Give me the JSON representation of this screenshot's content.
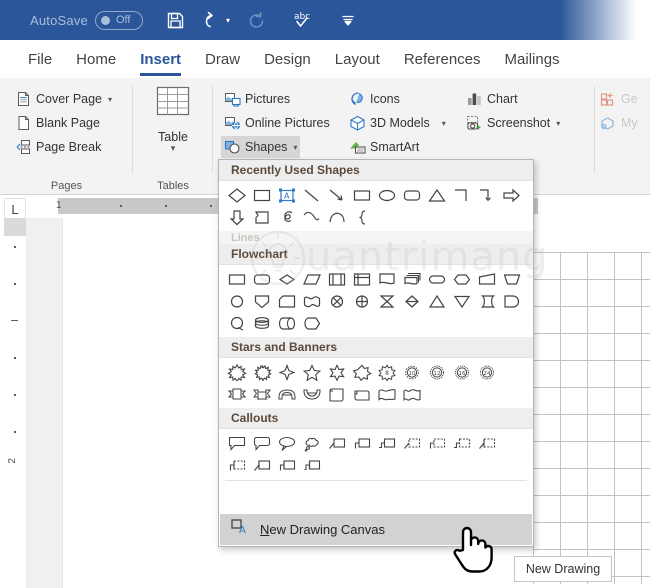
{
  "titlebar": {
    "autosave_label": "AutoSave",
    "autosave_state": "Off",
    "save_icon": "save-icon",
    "undo_icon": "undo-icon",
    "redo_icon": "redo-icon",
    "spelling_icon": "spelling-check-icon",
    "customize_icon": "customize-quick-access-toolbar-icon",
    "accent_color": "#2b579a"
  },
  "tabs": [
    {
      "label": "File",
      "active": false
    },
    {
      "label": "Home",
      "active": false
    },
    {
      "label": "Insert",
      "active": true
    },
    {
      "label": "Draw",
      "active": false
    },
    {
      "label": "Design",
      "active": false
    },
    {
      "label": "Layout",
      "active": false
    },
    {
      "label": "References",
      "active": false
    },
    {
      "label": "Mailings",
      "active": false
    }
  ],
  "ribbon": {
    "groups": [
      {
        "name": "Pages",
        "label": "Pages"
      },
      {
        "name": "Tables",
        "label": "Tables"
      },
      {
        "name": "Illustrations",
        "label": ""
      },
      {
        "name": "Add-ins",
        "label": ""
      }
    ],
    "pages": {
      "cover_page": "Cover Page",
      "blank_page": "Blank Page",
      "page_break": "Page Break"
    },
    "tables": {
      "table": "Table"
    },
    "illustrations": {
      "pictures": "Pictures",
      "online_pictures": "Online Pictures",
      "shapes": "Shapes",
      "icons": "Icons",
      "models_3d": "3D Models",
      "smartart": "SmartArt",
      "chart": "Chart",
      "screenshot": "Screenshot"
    },
    "addins": {
      "get_addins": "Ge",
      "my_addins": "My"
    }
  },
  "shapes_menu": {
    "sections": [
      {
        "title": "Recently Used Shapes",
        "faded": false,
        "rows": [
          [
            "diamond",
            "rectangle",
            "text-box",
            "line",
            "line-arrow",
            "rectangle",
            "oval",
            "rounded-rectangle",
            "isosceles-triangle",
            "elbow-connector",
            "elbow-arrow-connector",
            "right-arrow"
          ],
          [
            "down-arrow",
            "pentagon-flag",
            "scribble",
            "curve",
            "arc",
            "left-brace"
          ]
        ]
      },
      {
        "title": "Lines",
        "faded": true,
        "rows": []
      },
      {
        "title": "Flowchart",
        "faded": false,
        "rows": [
          [
            "flowchart-process",
            "flowchart-alternate-process",
            "flowchart-decision",
            "flowchart-data",
            "flowchart-predefined-process",
            "flowchart-internal-storage",
            "flowchart-document",
            "flowchart-multidocument",
            "flowchart-terminator",
            "flowchart-preparation",
            "flowchart-manual-input",
            "flowchart-manual-operation"
          ],
          [
            "flowchart-connector",
            "flowchart-off-page-connector",
            "flowchart-card",
            "flowchart-punched-tape",
            "flowchart-summing-junction",
            "flowchart-or",
            "flowchart-collate",
            "flowchart-sort",
            "flowchart-extract",
            "flowchart-merge",
            "flowchart-stored-data",
            "flowchart-delay"
          ],
          [
            "flowchart-sequential-access-storage",
            "flowchart-magnetic-disk",
            "flowchart-direct-access-storage",
            "flowchart-display"
          ]
        ]
      },
      {
        "title": "Stars and Banners",
        "faded": false,
        "rows": [
          [
            "explosion-1",
            "explosion-2",
            "star-4-point",
            "star-5-point",
            "star-6-point",
            "star-7-point",
            "star-8-point",
            "star-10-point",
            "star-12-point",
            "star-16-point",
            "star-24-point"
          ],
          [
            "up-ribbon",
            "down-ribbon",
            "curved-up-ribbon",
            "curved-down-ribbon",
            "vertical-scroll",
            "horizontal-scroll",
            "wave",
            "double-wave"
          ]
        ]
      },
      {
        "title": "Callouts",
        "faded": false,
        "rows": [
          [
            "rectangular-callout",
            "rounded-rectangular-callout",
            "oval-callout",
            "cloud-callout",
            "line-callout-1",
            "line-callout-2",
            "line-callout-3",
            "line-callout-1-border-accent",
            "line-callout-2-border-accent",
            "line-callout-3-border-accent",
            "line-callout-1-accent-bar"
          ],
          [
            "line-callout-2-accent-bar",
            "line-callout-3-accent-bar",
            "line-callout-1-no-border",
            "line-callout-2-no-border"
          ]
        ]
      }
    ],
    "new_drawing_canvas": {
      "label_underlined": "N",
      "label_rest": "ew Drawing Canvas",
      "icon": "drawing-canvas-icon",
      "highlighted": true
    }
  },
  "document": {
    "corner_tab_stop": "L",
    "h_ruler_number": "1",
    "v_ruler_number": "2"
  },
  "tooltip": {
    "text": "New Drawing"
  },
  "watermark": {
    "text": "uantrimang"
  }
}
